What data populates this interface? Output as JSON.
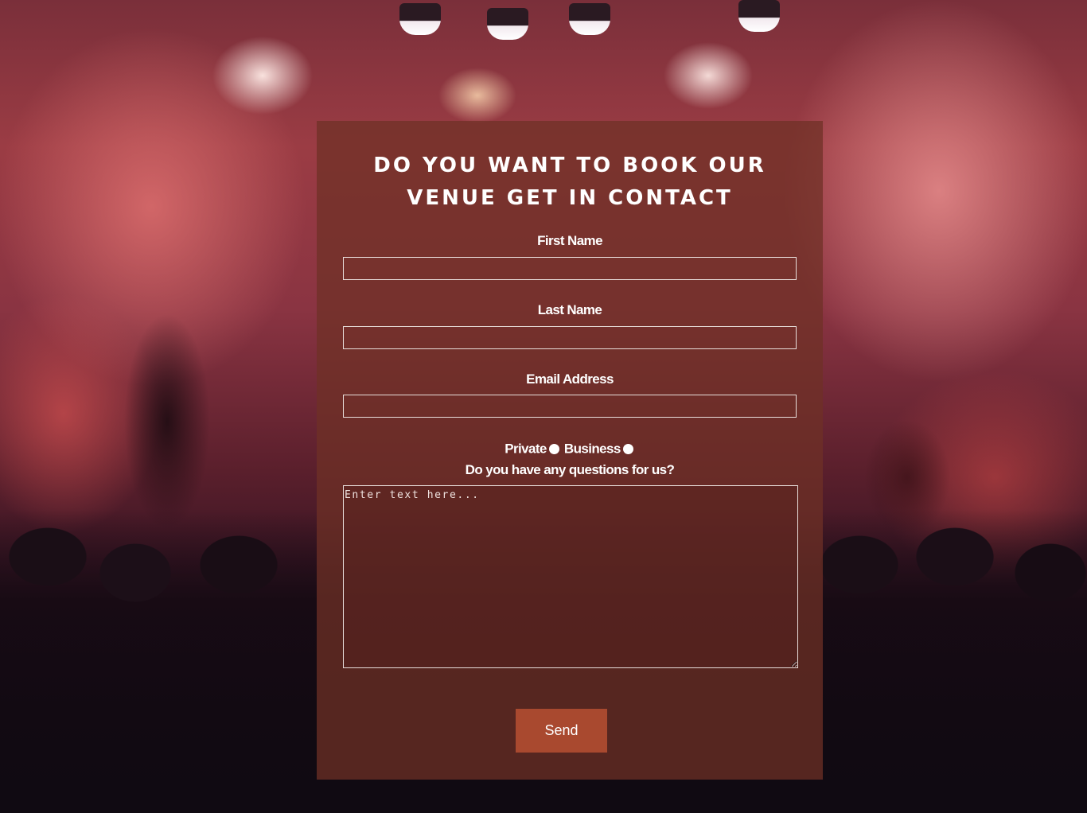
{
  "form": {
    "title": "DO YOU WANT TO BOOK OUR VENUE GET IN CONTACT",
    "fields": {
      "first_name_label": "First Name",
      "last_name_label": "Last Name",
      "email_label": "Email Address"
    },
    "type_options": {
      "private_label": "Private",
      "business_label": "Business"
    },
    "questions_label": "Do you have any questions for us?",
    "questions_placeholder": "Enter text here...",
    "send_label": "Send"
  },
  "colors": {
    "panel_bg": "#6e3026",
    "send_button": "#a9492f"
  }
}
